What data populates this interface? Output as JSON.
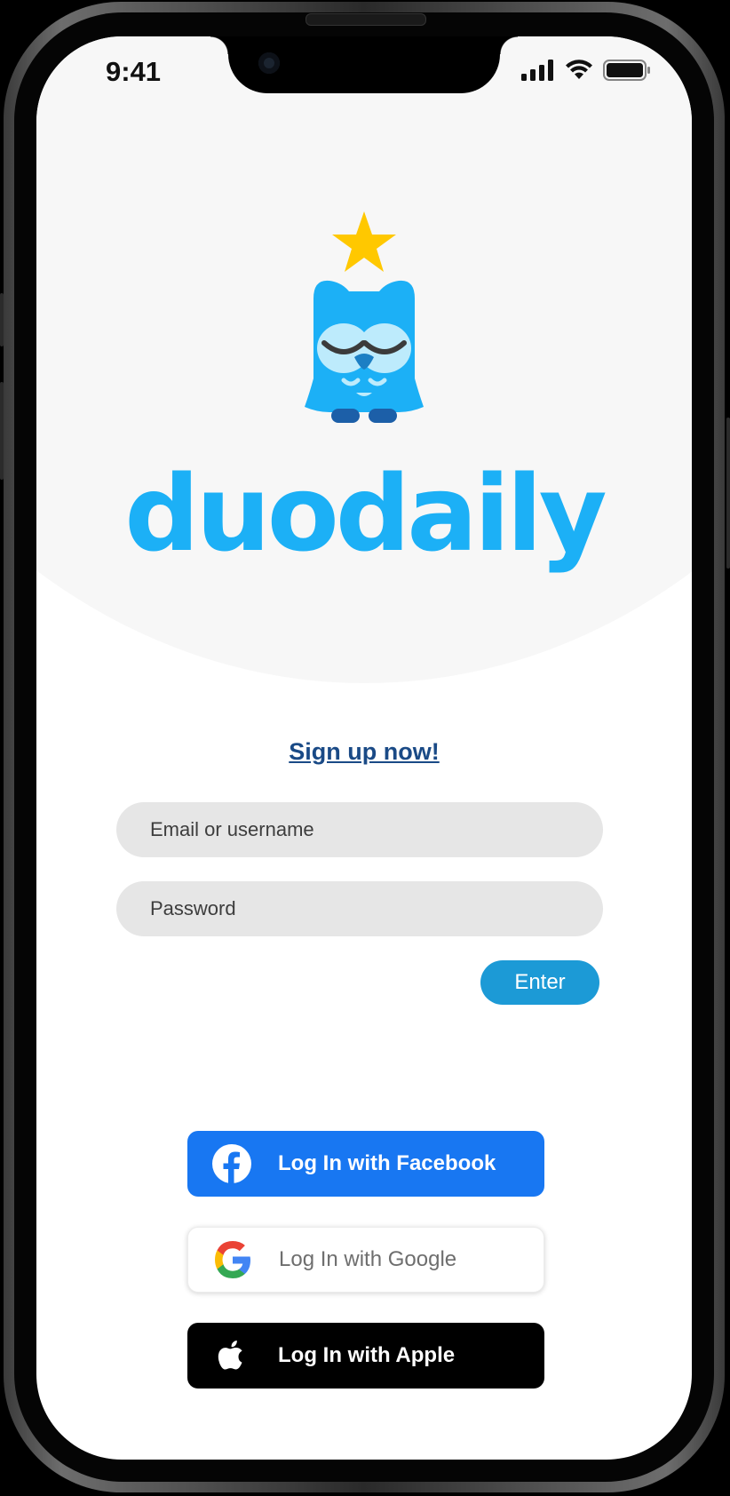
{
  "status_bar": {
    "time": "9:41"
  },
  "brand": {
    "name": "duodaily",
    "color": "#1cb0f6"
  },
  "signup": {
    "label": "Sign up now!"
  },
  "login_form": {
    "email_placeholder": "Email or username",
    "password_placeholder": "Password",
    "submit_label": "Enter"
  },
  "social_login": [
    {
      "label": "Log In with Facebook",
      "icon": "facebook-icon",
      "color": "#1877f2"
    },
    {
      "label": "Log In with Google",
      "icon": "google-icon",
      "color": "#ffffff"
    },
    {
      "label": "Log In with Apple",
      "icon": "apple-icon",
      "color": "#000000"
    }
  ]
}
